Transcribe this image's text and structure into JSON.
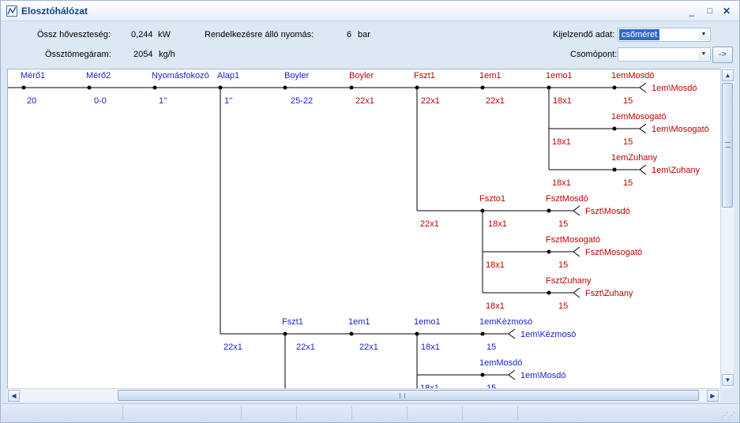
{
  "window": {
    "title": "Elosztóhálózat",
    "minimize": "_",
    "maximize": "□",
    "close": "✕"
  },
  "summary": {
    "total_loss_label": "Össz hőveszteség:",
    "total_loss_value": "0,244",
    "total_loss_unit": "kW",
    "total_flow_label": "Össztömegáram:",
    "total_flow_value": "2054",
    "total_flow_unit": "kg/h",
    "pressure_label": "Rendelkezésre álló nyomás:",
    "pressure_value": "6",
    "pressure_unit": "bar"
  },
  "controls": {
    "display_label": "Kijelzendő adat:",
    "display_value": "csőméret",
    "node_label": "Csomópont:",
    "node_value": "",
    "go_button": "->"
  },
  "colors": {
    "blue": "#1a24c8",
    "red": "#c00000",
    "line": "#000000"
  },
  "network": {
    "nodes": [
      {
        "label": "Mérő1",
        "value": "20",
        "color": "blue"
      },
      {
        "label": "Mérő2",
        "value": "0-0",
        "color": "blue"
      },
      {
        "label": "Nyomásfokozó",
        "value": "1''",
        "color": "blue"
      },
      {
        "label": "Alap1",
        "value": "1''",
        "color": "blue"
      },
      {
        "label": "Boyler",
        "value": "25-22",
        "color": "blue"
      },
      {
        "label": "Boyler",
        "value": "22x1",
        "color": "red"
      },
      {
        "label": "Fszt1",
        "value": "22x1",
        "color": "red"
      },
      {
        "label": "1em1",
        "value": "22x1",
        "color": "red"
      },
      {
        "label": "1emo1",
        "value": "18x1",
        "color": "red"
      },
      {
        "label": "1emMosdó",
        "value": "15",
        "color": "red"
      },
      {
        "label": "1emMosogató",
        "value": "15",
        "color": "red"
      },
      {
        "label": "1emZuhany",
        "value": "15",
        "color": "red"
      },
      {
        "label": "Fszto1",
        "value": "18x1",
        "color": "red"
      },
      {
        "label": "FsztMosdó",
        "value": "15",
        "color": "red"
      },
      {
        "label": "FsztMosogató",
        "value": "15",
        "color": "red"
      },
      {
        "label": "FsztZuhany",
        "value": "15",
        "color": "red"
      },
      {
        "label": "Fszt1",
        "value": "22x1",
        "color": "blue"
      },
      {
        "label": "1em1",
        "value": "22x1",
        "color": "blue"
      },
      {
        "label": "1emo1",
        "value": "18x1",
        "color": "blue"
      },
      {
        "label": "1emKézmosó",
        "value": "15",
        "color": "blue"
      },
      {
        "label": "1emMosdó",
        "value": "15",
        "color": "blue"
      }
    ],
    "extra_values": [
      {
        "value": "18x1",
        "color": "red"
      },
      {
        "value": "18x1",
        "color": "red"
      },
      {
        "value": "22x1",
        "color": "red"
      },
      {
        "value": "18x1",
        "color": "red"
      },
      {
        "value": "18x1",
        "color": "red"
      },
      {
        "value": "22x1",
        "color": "blue"
      },
      {
        "value": "18x1",
        "color": "blue"
      }
    ],
    "terminals": [
      {
        "label": "1em\\Mosdó",
        "color": "red"
      },
      {
        "label": "1em\\Mosogató",
        "color": "red"
      },
      {
        "label": "1em\\Zuhany",
        "color": "red"
      },
      {
        "label": "Fszt\\Mosdó",
        "color": "red"
      },
      {
        "label": "Fszt\\Mosogató",
        "color": "red"
      },
      {
        "label": "Fszt\\Zuhany",
        "color": "red"
      },
      {
        "label": "1em\\Kézmosó",
        "color": "blue"
      },
      {
        "label": "1em\\Mosdó",
        "color": "blue"
      }
    ]
  }
}
